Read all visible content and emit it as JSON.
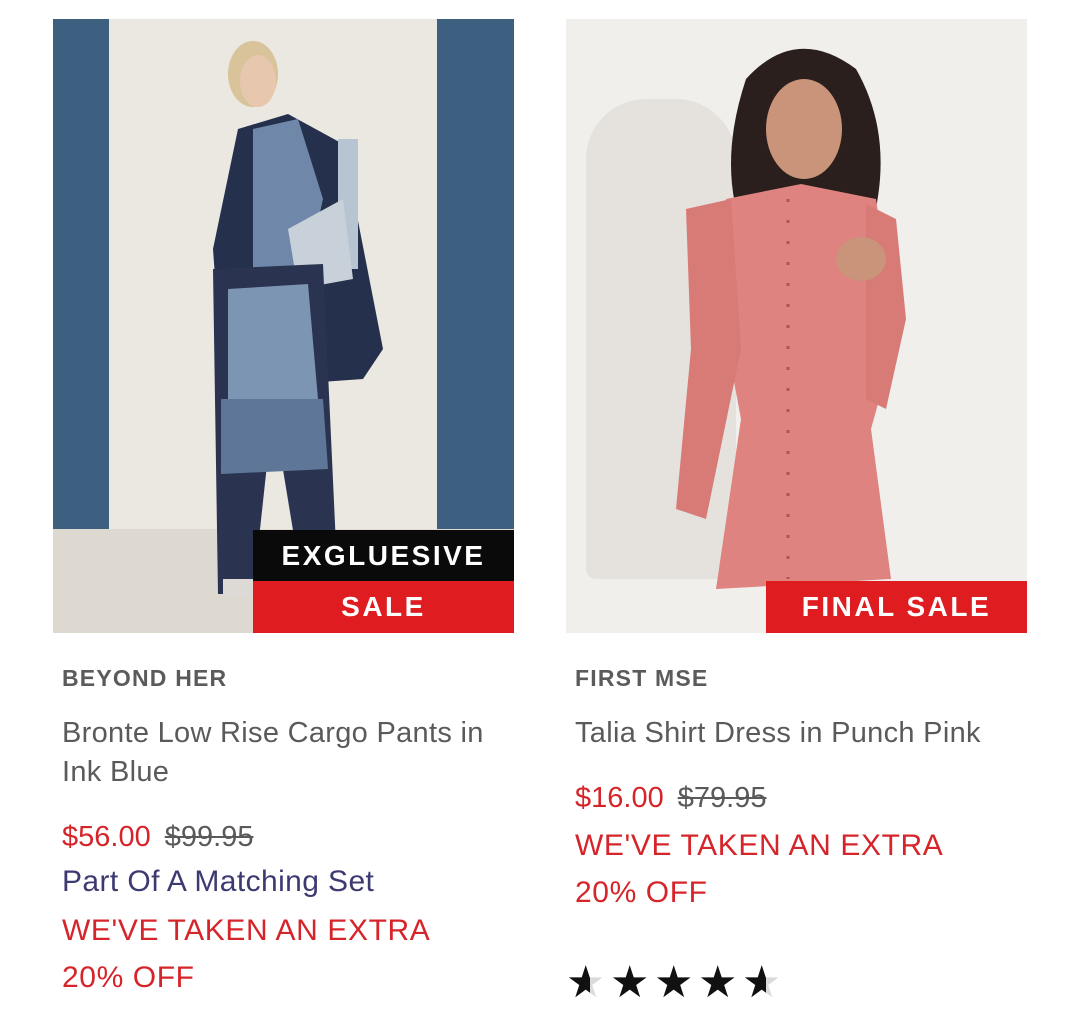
{
  "products": [
    {
      "brand": "BEYOND HER",
      "name": "Bronte Low Rise Cargo Pants in Ink Blue",
      "price_sale": "$56.00",
      "price_original": "$99.95",
      "badge_top": "EXGLUESIVE",
      "badge_bottom": "SALE",
      "set_text": "Part Of A Matching Set",
      "extra_line1": "WE'VE TAKEN AN EXTRA",
      "extra_line2": "20% OFF"
    },
    {
      "brand": "FIRST MSE",
      "name": "Talia Shirt Dress in Punch Pink",
      "price_sale": "$16.00",
      "price_original": "$79.95",
      "badge_bottom": "FINAL SALE",
      "extra_line1": "WE'VE TAKEN AN EXTRA",
      "extra_line2": "20% OFF",
      "rating": 4.5
    }
  ],
  "colors": {
    "sale_red": "#df1c20",
    "price_red": "#d6252a",
    "set_blue": "#3d3a71"
  },
  "icons": {
    "star": "star-icon",
    "half_star": "half-star-icon"
  }
}
